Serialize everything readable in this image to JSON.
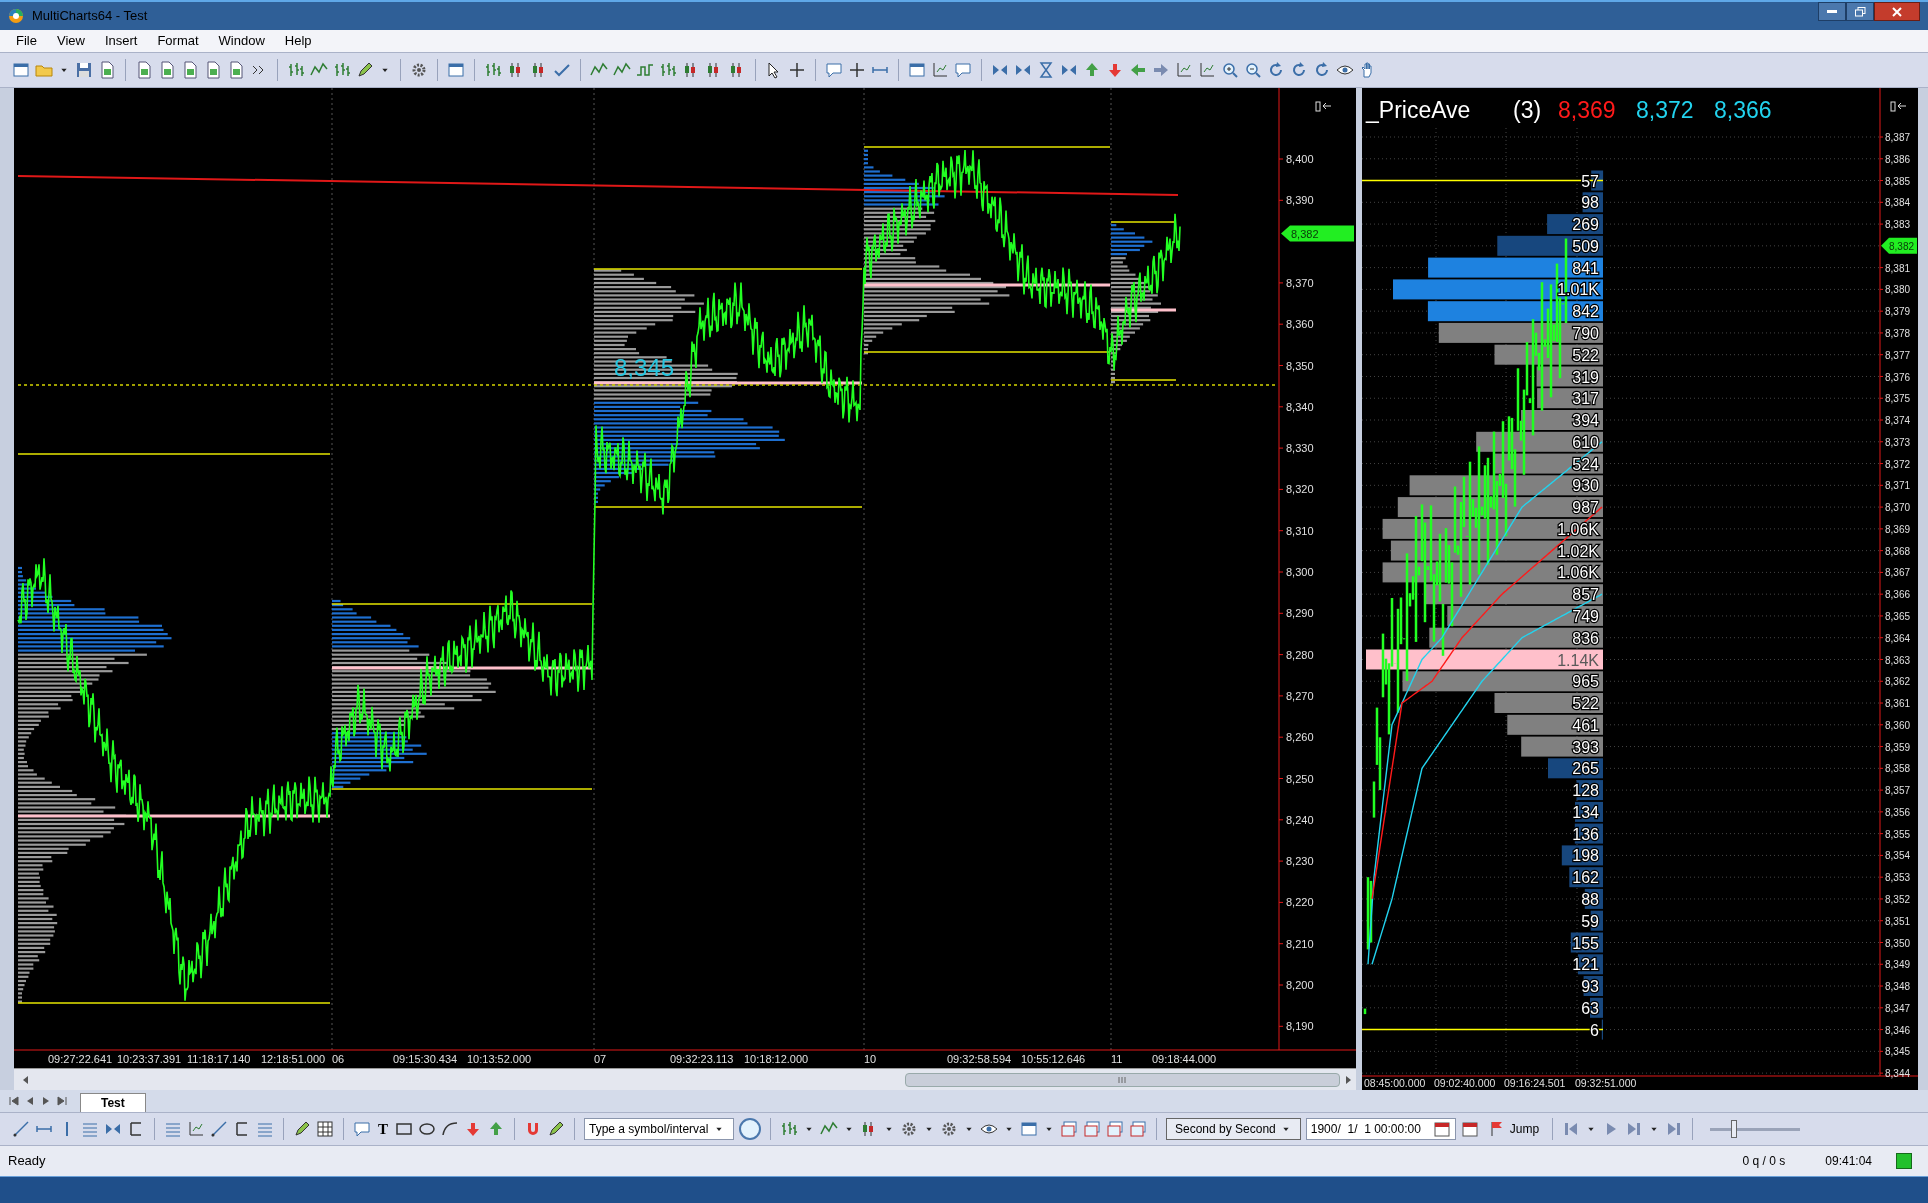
{
  "window": {
    "title": "MultiCharts64 - Test"
  },
  "menu": [
    "File",
    "View",
    "Insert",
    "Format",
    "Window",
    "Help"
  ],
  "charts": [
    {
      "kind": "session-profile",
      "poc_label": "8,345",
      "price_axis": [
        {
          "label": "8,400",
          "kind": "tick"
        },
        {
          "label": "8,390",
          "kind": "tick"
        },
        {
          "label": "8,382",
          "kind": "current"
        },
        {
          "label": "8,370",
          "kind": "tick"
        },
        {
          "label": "8,360",
          "kind": "tick"
        },
        {
          "label": "8,350",
          "kind": "tick"
        },
        {
          "label": "8,340",
          "kind": "tick"
        },
        {
          "label": "8,330",
          "kind": "tick"
        },
        {
          "label": "8,320",
          "kind": "tick"
        },
        {
          "label": "8,310",
          "kind": "tick"
        },
        {
          "label": "8,300",
          "kind": "tick"
        },
        {
          "label": "8,290",
          "kind": "tick"
        },
        {
          "label": "8,280",
          "kind": "tick"
        },
        {
          "label": "8,270",
          "kind": "tick"
        },
        {
          "label": "8,260",
          "kind": "tick"
        },
        {
          "label": "8,250",
          "kind": "tick"
        },
        {
          "label": "8,240",
          "kind": "tick"
        },
        {
          "label": "8,230",
          "kind": "tick"
        },
        {
          "label": "8,220",
          "kind": "tick"
        },
        {
          "label": "8,210",
          "kind": "tick"
        },
        {
          "label": "8,200",
          "kind": "tick"
        },
        {
          "label": "8,190",
          "kind": "tick"
        }
      ],
      "time_axis": [
        "09:27:22.641",
        "10:23:37.391",
        "11:18:17.140",
        "12:18:51.000",
        "06",
        "09:15:30.434",
        "10:13:52.000",
        "07",
        "09:32:23.113",
        "10:18:12.000",
        "10",
        "09:32:58.594",
        "10:55:12.646",
        "11",
        "09:18:44.000"
      ]
    },
    {
      "kind": "price-ave",
      "study": {
        "name": "_PriceAve",
        "length": "(3)",
        "values": [
          {
            "text": "8,369",
            "color": "#ff1a1a"
          },
          {
            "text": "8,372",
            "color": "#22d3ee"
          },
          {
            "text": "8,366",
            "color": "#22d3ee"
          }
        ]
      },
      "profile": [
        {
          "volume": "57",
          "level": 0.05,
          "kind": "outer"
        },
        {
          "volume": "98",
          "level": 0.086,
          "kind": "outer"
        },
        {
          "volume": "269",
          "level": 0.236,
          "kind": "outer"
        },
        {
          "volume": "509",
          "level": 0.446,
          "kind": "outer"
        },
        {
          "volume": "841",
          "level": 0.738,
          "kind": "peak"
        },
        {
          "volume": "1.01K",
          "level": 0.886,
          "kind": "peak"
        },
        {
          "volume": "842",
          "level": 0.739,
          "kind": "peak"
        },
        {
          "volume": "790",
          "level": 0.693,
          "kind": "value"
        },
        {
          "volume": "522",
          "level": 0.458,
          "kind": "value"
        },
        {
          "volume": "319",
          "level": 0.28,
          "kind": "value"
        },
        {
          "volume": "317",
          "level": 0.278,
          "kind": "value"
        },
        {
          "volume": "394",
          "level": 0.346,
          "kind": "value"
        },
        {
          "volume": "610",
          "level": 0.535,
          "kind": "value"
        },
        {
          "volume": "524",
          "level": 0.46,
          "kind": "value"
        },
        {
          "volume": "930",
          "level": 0.816,
          "kind": "value"
        },
        {
          "volume": "987",
          "level": 0.866,
          "kind": "value"
        },
        {
          "volume": "1.06K",
          "level": 0.93,
          "kind": "value"
        },
        {
          "volume": "1.02K",
          "level": 0.895,
          "kind": "value"
        },
        {
          "volume": "1.06K",
          "level": 0.93,
          "kind": "value"
        },
        {
          "volume": "857",
          "level": 0.752,
          "kind": "value"
        },
        {
          "volume": "749",
          "level": 0.657,
          "kind": "value"
        },
        {
          "volume": "836",
          "level": 0.733,
          "kind": "value"
        },
        {
          "volume": "1.14K",
          "level": 1,
          "kind": "poc"
        },
        {
          "volume": "965",
          "level": 0.846,
          "kind": "value"
        },
        {
          "volume": "522",
          "level": 0.458,
          "kind": "value"
        },
        {
          "volume": "461",
          "level": 0.404,
          "kind": "value"
        },
        {
          "volume": "393",
          "level": 0.345,
          "kind": "value"
        },
        {
          "volume": "265",
          "level": 0.232,
          "kind": "outer"
        },
        {
          "volume": "128",
          "level": 0.112,
          "kind": "outer"
        },
        {
          "volume": "134",
          "level": 0.118,
          "kind": "outer"
        },
        {
          "volume": "136",
          "level": 0.119,
          "kind": "outer"
        },
        {
          "volume": "198",
          "level": 0.174,
          "kind": "outer"
        },
        {
          "volume": "162",
          "level": 0.142,
          "kind": "outer"
        },
        {
          "volume": "88",
          "level": 0.077,
          "kind": "outer"
        },
        {
          "volume": "59",
          "level": 0.052,
          "kind": "outer"
        },
        {
          "volume": "155",
          "level": 0.136,
          "kind": "outer"
        },
        {
          "volume": "121",
          "level": 0.106,
          "kind": "outer"
        },
        {
          "volume": "93",
          "level": 0.082,
          "kind": "outer"
        },
        {
          "volume": "63",
          "level": 0.055,
          "kind": "outer"
        },
        {
          "volume": "6",
          "level": 0.005,
          "kind": "outer"
        }
      ],
      "price_axis": [
        {
          "label": "8,387",
          "kind": "tick"
        },
        {
          "label": "8,386",
          "kind": "tick"
        },
        {
          "label": "8,385",
          "kind": "tick"
        },
        {
          "label": "8,384",
          "kind": "tick"
        },
        {
          "label": "8,383",
          "kind": "tick"
        },
        {
          "label": "8,382",
          "kind": "current"
        },
        {
          "label": "8,381",
          "kind": "tick"
        },
        {
          "label": "8,380",
          "kind": "tick"
        },
        {
          "label": "8,379",
          "kind": "tick"
        },
        {
          "label": "8,378",
          "kind": "tick"
        },
        {
          "label": "8,377",
          "kind": "tick"
        },
        {
          "label": "8,376",
          "kind": "tick"
        },
        {
          "label": "8,375",
          "kind": "tick"
        },
        {
          "label": "8,374",
          "kind": "tick"
        },
        {
          "label": "8,373",
          "kind": "tick"
        },
        {
          "label": "8,372",
          "kind": "tick"
        },
        {
          "label": "8,371",
          "kind": "tick"
        },
        {
          "label": "8,370",
          "kind": "tick"
        },
        {
          "label": "8,369",
          "kind": "tick"
        },
        {
          "label": "8,368",
          "kind": "tick"
        },
        {
          "label": "8,367",
          "kind": "tick"
        },
        {
          "label": "8,366",
          "kind": "tick"
        },
        {
          "label": "8,365",
          "kind": "tick"
        },
        {
          "label": "8,364",
          "kind": "tick"
        },
        {
          "label": "8,363",
          "kind": "tick"
        },
        {
          "label": "8,362",
          "kind": "tick"
        },
        {
          "label": "8,361",
          "kind": "tick"
        },
        {
          "label": "8,360",
          "kind": "tick"
        },
        {
          "label": "8,359",
          "kind": "tick"
        },
        {
          "label": "8,358",
          "kind": "tick"
        },
        {
          "label": "8,357",
          "kind": "tick"
        },
        {
          "label": "8,356",
          "kind": "tick"
        },
        {
          "label": "8,355",
          "kind": "tick"
        },
        {
          "label": "8,354",
          "kind": "tick"
        },
        {
          "label": "8,353",
          "kind": "tick"
        },
        {
          "label": "8,352",
          "kind": "tick"
        },
        {
          "label": "8,351",
          "kind": "tick"
        },
        {
          "label": "8,350",
          "kind": "tick"
        },
        {
          "label": "8,349",
          "kind": "tick"
        },
        {
          "label": "8,348",
          "kind": "tick"
        },
        {
          "label": "8,347",
          "kind": "tick"
        },
        {
          "label": "8,346",
          "kind": "tick"
        },
        {
          "label": "8,345",
          "kind": "tick"
        },
        {
          "label": "8,344",
          "kind": "tick"
        }
      ],
      "time_axis": [
        "08:45:00.000",
        "09:02:40.000",
        "09:16:24.501",
        "09:32:51.000"
      ]
    }
  ],
  "sheet_tabs": [
    {
      "label": "Test",
      "selected": true
    }
  ],
  "text_tool": "T",
  "symbol_field": {
    "placeholder": "Type a symbol/interval"
  },
  "playback_mode": "Second by Second",
  "jump_date": "1900/  1/  1 00:00:00",
  "jump_button": "Jump",
  "speed_slider": {
    "level": 0.25
  },
  "status": {
    "text": "Ready",
    "quotes": "0 q / 0 s",
    "time": "09:41:04"
  }
}
